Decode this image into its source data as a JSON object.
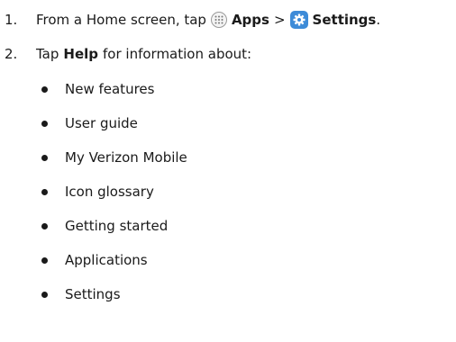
{
  "steps": [
    {
      "number": "1.",
      "parts": {
        "prefix": "From a Home screen, tap",
        "apps_label": "Apps",
        "separator": ">",
        "settings_label": "Settings",
        "suffix": "."
      },
      "icons": [
        "apps-icon",
        "settings-icon"
      ]
    },
    {
      "number": "2.",
      "parts": {
        "prefix": "Tap",
        "help_label": "Help",
        "suffix": "for information about:"
      }
    }
  ],
  "bullets": [
    "New features",
    "User guide",
    "My Verizon Mobile",
    "Icon glossary",
    "Getting started",
    "Applications",
    "Settings"
  ],
  "colors": {
    "settings_icon_bg": "#3d8bd8",
    "text": "#1a1a1a"
  }
}
